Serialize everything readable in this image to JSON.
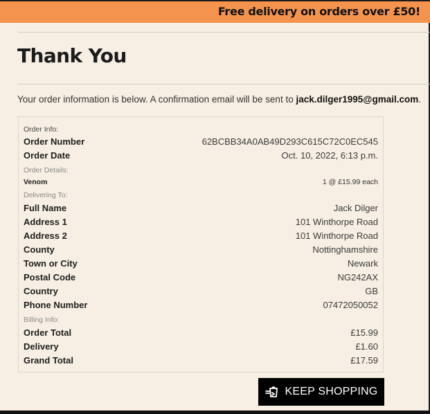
{
  "banner": {
    "text": "Free delivery on orders over £50!"
  },
  "page": {
    "title": "Thank You",
    "intro_text": "Your order information is below. A confirmation email will be sent to ",
    "email": "jack.dilger1995@gmail.com",
    "intro_end": "."
  },
  "order": {
    "info_label": "Order Info:",
    "number_label": "Order Number",
    "number": "62BCBB34A0AB49D293C615C72C0EC545",
    "date_label": "Order Date",
    "date": "Oct. 10, 2022, 6:13 p.m.",
    "details_label": "Order Details:",
    "items": [
      {
        "name": "Venom",
        "detail": "1 @ £15.99 each"
      }
    ]
  },
  "delivery": {
    "section_label": "Delivering To:",
    "fields": [
      {
        "label": "Full Name",
        "value": "Jack Dilger"
      },
      {
        "label": "Address 1",
        "value": "101 Winthorpe Road"
      },
      {
        "label": "Address 2",
        "value": "101 Winthorpe Road"
      },
      {
        "label": "County",
        "value": "Nottinghamshire"
      },
      {
        "label": "Town or City",
        "value": "Newark"
      },
      {
        "label": "Postal Code",
        "value": "NG242AX"
      },
      {
        "label": "Country",
        "value": "GB"
      },
      {
        "label": "Phone Number",
        "value": "07472050052"
      }
    ]
  },
  "billing": {
    "section_label": "Billing Info:",
    "fields": [
      {
        "label": "Order Total",
        "value": "£15.99"
      },
      {
        "label": "Delivery",
        "value": "£1.60"
      },
      {
        "label": "Grand Total",
        "value": "£17.59"
      }
    ]
  },
  "actions": {
    "keep_shopping_label": "KEEP SHOPPING",
    "keep_shopping_icon": "shopping-bag-arrow-icon"
  },
  "colors": {
    "background": "#f7efe3",
    "banner": "#f4934e",
    "button": "#000000"
  }
}
